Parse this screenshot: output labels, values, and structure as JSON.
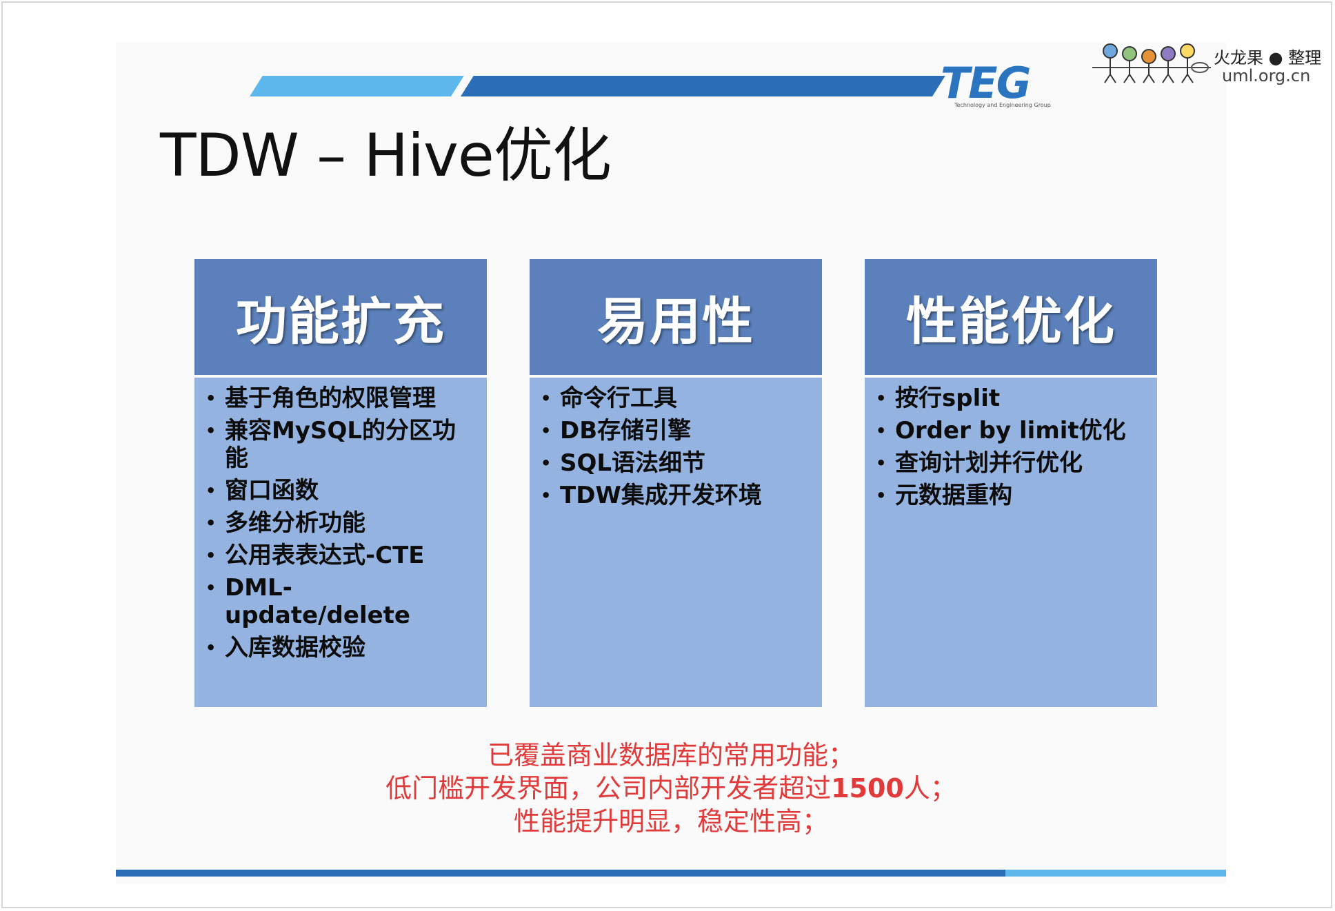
{
  "header": {
    "logo_text": "TEG",
    "logo_subtitle": "Technology and Engineering Group",
    "uml_brand": "火龙果 ● 整理",
    "uml_site": "uml.org.cn"
  },
  "title": "TDW – Hive优化",
  "panels": [
    {
      "heading": "功能扩充",
      "items": [
        "基于角色的权限管理",
        "兼容MySQL的分区功能",
        "窗口函数",
        "多维分析功能",
        "公用表表达式-CTE",
        "DML-update/delete",
        "入库数据校验"
      ]
    },
    {
      "heading": "易用性",
      "items": [
        "命令行工具",
        "DB存储引擎",
        "SQL语法细节",
        "TDW集成开发环境"
      ]
    },
    {
      "heading": "性能优化",
      "items": [
        "按行split",
        "Order by limit优化",
        "查询计划并行优化",
        "元数据重构"
      ]
    }
  ],
  "summary": {
    "line1": "已覆盖商业数据库的常用功能；",
    "line2_prefix": "低门槛开发界面，公司内部开发者超过",
    "line2_number": "1500",
    "line2_suffix": "人；",
    "line3": "性能提升明显，稳定性高；"
  },
  "colors": {
    "accent_dark": "#2b6db7",
    "accent_light": "#5cb8ec",
    "panel_header": "#5b80bb",
    "panel_body": "#95b3e0",
    "summary_text": "#e03a3a"
  }
}
